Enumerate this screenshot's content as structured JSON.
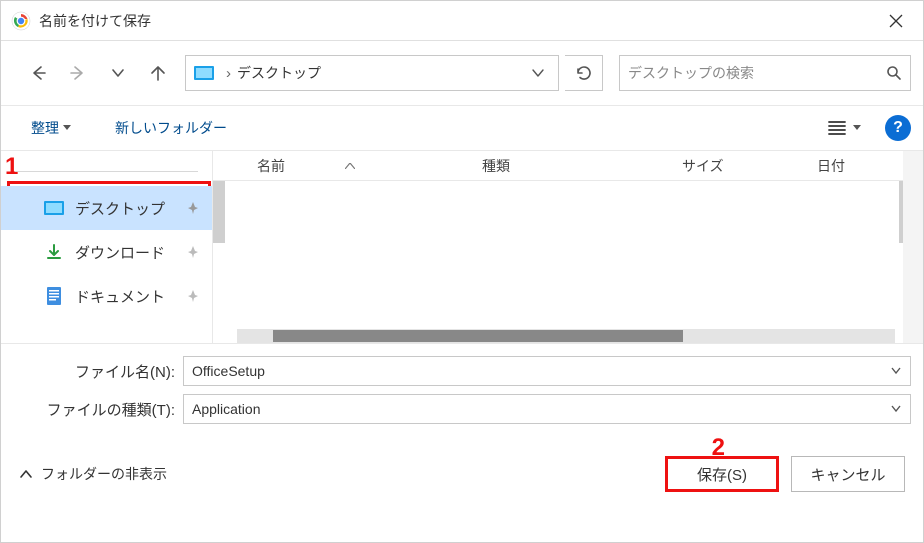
{
  "window": {
    "title": "名前を付けて保存"
  },
  "breadcrumb": {
    "current": "デスクトップ"
  },
  "search": {
    "placeholder": "デスクトップの検索"
  },
  "toolbar": {
    "organize": "整理",
    "new_folder": "新しいフォルダー"
  },
  "sidebar": {
    "items": [
      {
        "label": "デスクトップ"
      },
      {
        "label": "ダウンロード"
      },
      {
        "label": "ドキュメント"
      }
    ]
  },
  "columns": {
    "name": "名前",
    "type": "種類",
    "size": "サイズ",
    "date": "日付"
  },
  "fields": {
    "filename_label": "ファイル名(N):",
    "filename_value": "OfficeSetup",
    "type_label": "ファイルの種類(T):",
    "type_value": "Application"
  },
  "bottom": {
    "folders_toggle": "フォルダーの非表示",
    "save": "保存(S)",
    "cancel": "キャンセル"
  },
  "annotations": {
    "num1": "1",
    "num2": "2"
  }
}
